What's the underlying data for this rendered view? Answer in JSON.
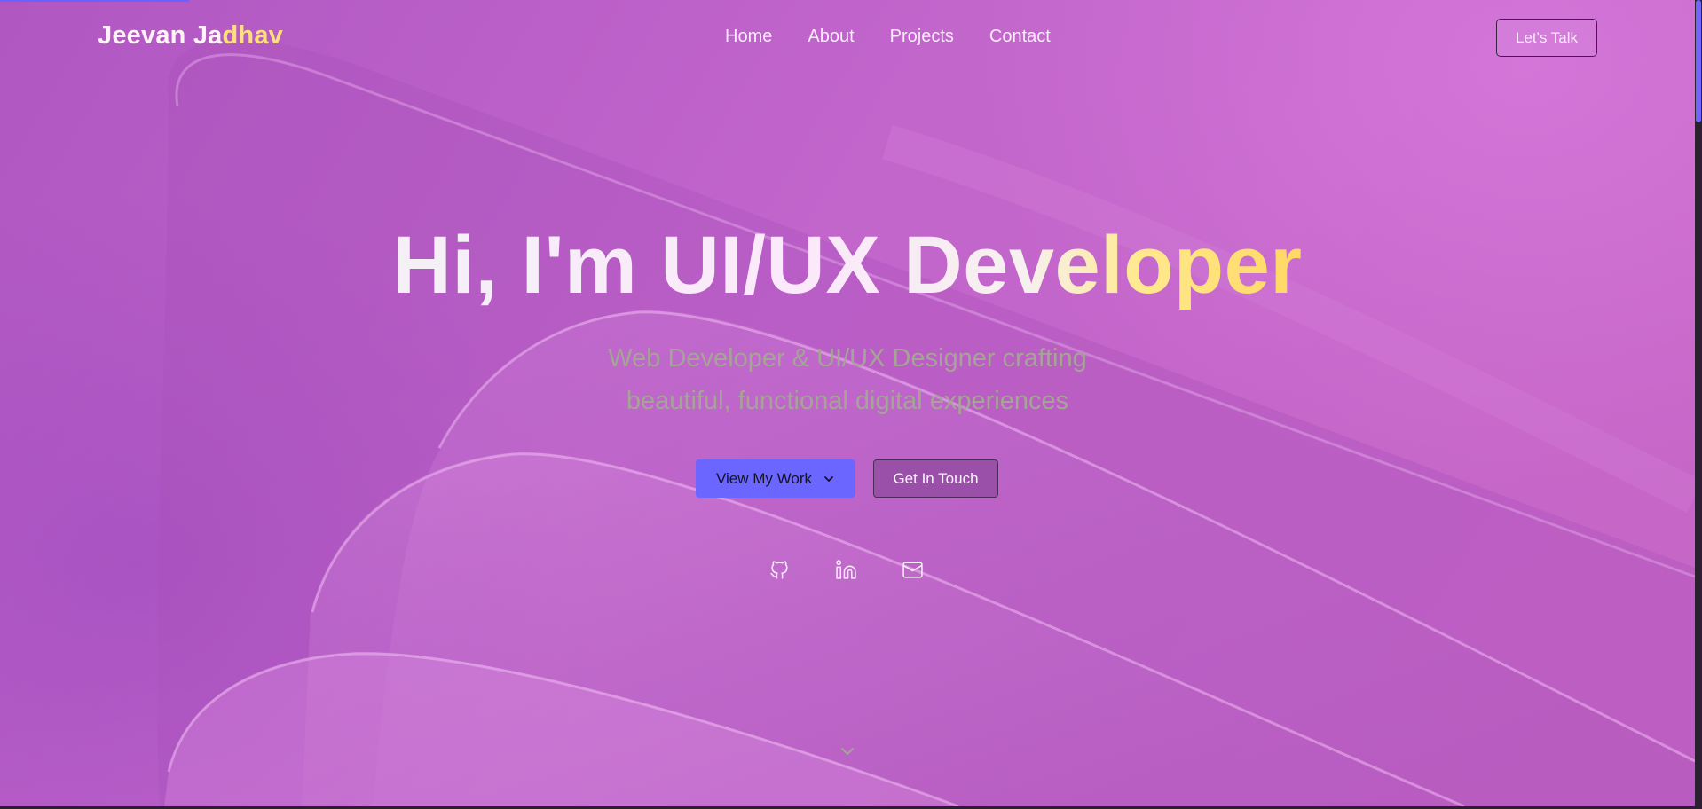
{
  "header": {
    "brand_main": "Jeevan Ja",
    "brand_accent": "dhav",
    "nav": [
      "Home",
      "About",
      "Projects",
      "Contact"
    ],
    "cta_label": "Let's Talk"
  },
  "hero": {
    "headline": "Hi, I'm UI/UX Developer",
    "subtitle_line1": "Web Developer & UI/UX Designer crafting",
    "subtitle_line2": "beautiful, functional digital experiences",
    "primary_button": "View My Work",
    "secondary_button": "Get In Touch",
    "social_icons": [
      "github-icon",
      "linkedin-icon",
      "mail-icon"
    ],
    "scroll_icon": "chevron-down-icon"
  },
  "colors": {
    "background": "#c266cc",
    "accent_yellow": "#ffe07a",
    "primary_button": "#6a66ff",
    "secondary_button": "#9a4fa8",
    "subtitle": "#a6a497"
  }
}
